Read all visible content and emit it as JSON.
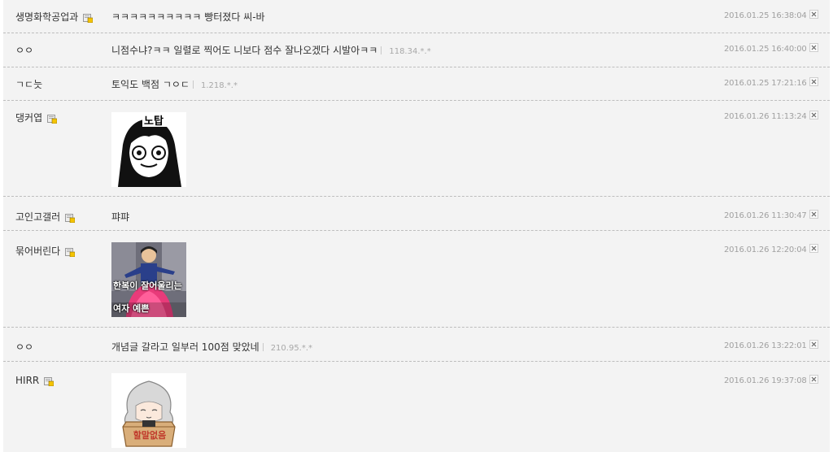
{
  "comments": [
    {
      "nick": "생명화학공업과",
      "has_icon": true,
      "text": "ㅋㅋㅋㅋㅋㅋㅋㅋㅋㅋ 빵터졌다 씨-바",
      "ip": "",
      "date": "2016.01.25 16:38:04"
    },
    {
      "nick": "ㅇㅇ",
      "has_icon": false,
      "text": "니점수냐?ㅋㅋ 일렬로 찍어도 니보다 점수 잘나오겠다 시발아ㅋㅋ",
      "ip": "118.34.*.*",
      "date": "2016.01.25 16:40:00"
    },
    {
      "nick": "ㄱㄷ늣",
      "has_icon": false,
      "text": "토익도 백점 ㄱㅇㄷ",
      "ip": "1.218.*.*",
      "date": "2016.01.25 17:21:16"
    },
    {
      "nick": "댕커엽",
      "has_icon": true,
      "image": "dccon-notap",
      "image_text": "노탑",
      "date": "2016.01.26 11:13:24"
    },
    {
      "nick": "고인고갤러",
      "has_icon": true,
      "text": "퍄퍄",
      "ip": "",
      "date": "2016.01.26 11:30:47"
    },
    {
      "nick": "묶어버린다",
      "has_icon": true,
      "image": "dccon-hanbok",
      "image_text": "한복이 잘어울리는 여자 예쁜",
      "date": "2016.01.26 12:20:04"
    },
    {
      "nick": "ㅇㅇ",
      "has_icon": false,
      "text": "개념글 갈라고 일부러 100점 맞았네",
      "ip": "210.95.*.*",
      "date": "2016.01.26 13:22:01"
    },
    {
      "nick": "HIRR",
      "has_icon": true,
      "image": "dccon-box-girl",
      "image_text": "할말없음",
      "date": "2016.01.26 19:37:08"
    }
  ]
}
